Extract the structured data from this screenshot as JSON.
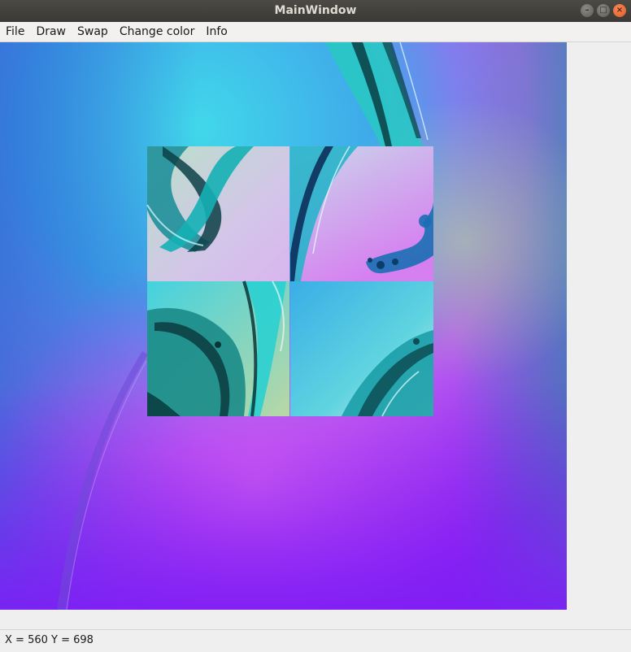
{
  "window": {
    "title": "MainWindow",
    "buttons": [
      "minimize-icon",
      "maximize-icon",
      "close-icon"
    ]
  },
  "menu": {
    "items": [
      "File",
      "Draw",
      "Swap",
      "Change color",
      "Info"
    ]
  },
  "canvas": {
    "description_icon": "wallpaper-image",
    "tiles_grid": "2x2",
    "colors": {
      "top_left": "#2f74d8",
      "top_center": "#2fd4e6",
      "teal": "#1aa39a",
      "mid_blue": "#5aa6ee",
      "magenta": "#d65cf2",
      "violet": "#9a20f2",
      "deep_violet": "#7e1ef5"
    }
  },
  "status": {
    "text": "X = 560 Y = 698"
  }
}
